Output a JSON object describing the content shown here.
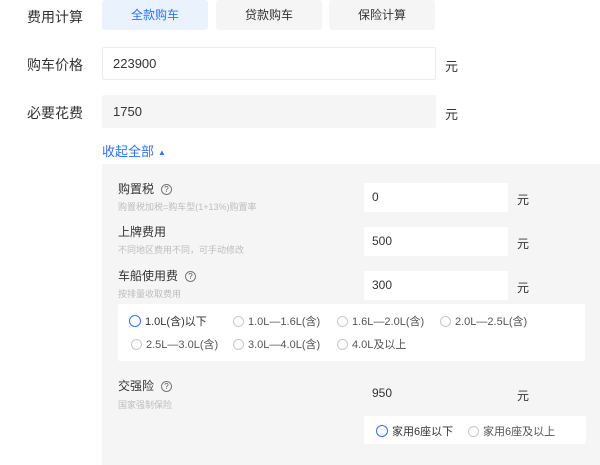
{
  "labels": {
    "fee_calc": "费用计算",
    "car_price": "购车价格",
    "required_cost": "必要花费"
  },
  "tabs": [
    {
      "label": "全款购车",
      "active": true
    },
    {
      "label": "贷款购车",
      "active": false
    },
    {
      "label": "保险计算",
      "active": false
    }
  ],
  "car_price": {
    "value": "223900",
    "unit": "元"
  },
  "required_cost": {
    "value": "1750",
    "unit": "元"
  },
  "collapse": {
    "label": "收起全部",
    "arrow": "▲"
  },
  "details": {
    "purchase_tax": {
      "title": "购置税",
      "desc": "购置税加税=购车型(1+13%)购置率",
      "value": "0",
      "unit": "元"
    },
    "plate_fee": {
      "title": "上牌费用",
      "desc": "不同地区费用不同，可手动修改",
      "value": "500",
      "unit": "元"
    },
    "vessel_tax": {
      "title": "车船使用费",
      "desc": "按排量收取费用",
      "value": "300",
      "unit": "元"
    },
    "displacement_options": [
      "1.0L(含)以下",
      "1.0L—1.6L(含)",
      "1.6L—2.0L(含)",
      "2.0L—2.5L(含)",
      "2.5L—3.0L(含)",
      "3.0L—4.0L(含)",
      "4.0L及以上"
    ],
    "displacement_selected": 0,
    "compulsory_insurance": {
      "title": "交强险",
      "desc": "国家强制保险",
      "value": "950",
      "unit": "元"
    },
    "seat_options": [
      "家用6座以下",
      "家用6座及以上"
    ],
    "seat_selected": 0
  },
  "help_icon_glyph": "?",
  "colors": {
    "accent": "#2f73f0",
    "tab_active_bg": "#eaf2fe",
    "panel_bg": "#f5f5f5"
  }
}
